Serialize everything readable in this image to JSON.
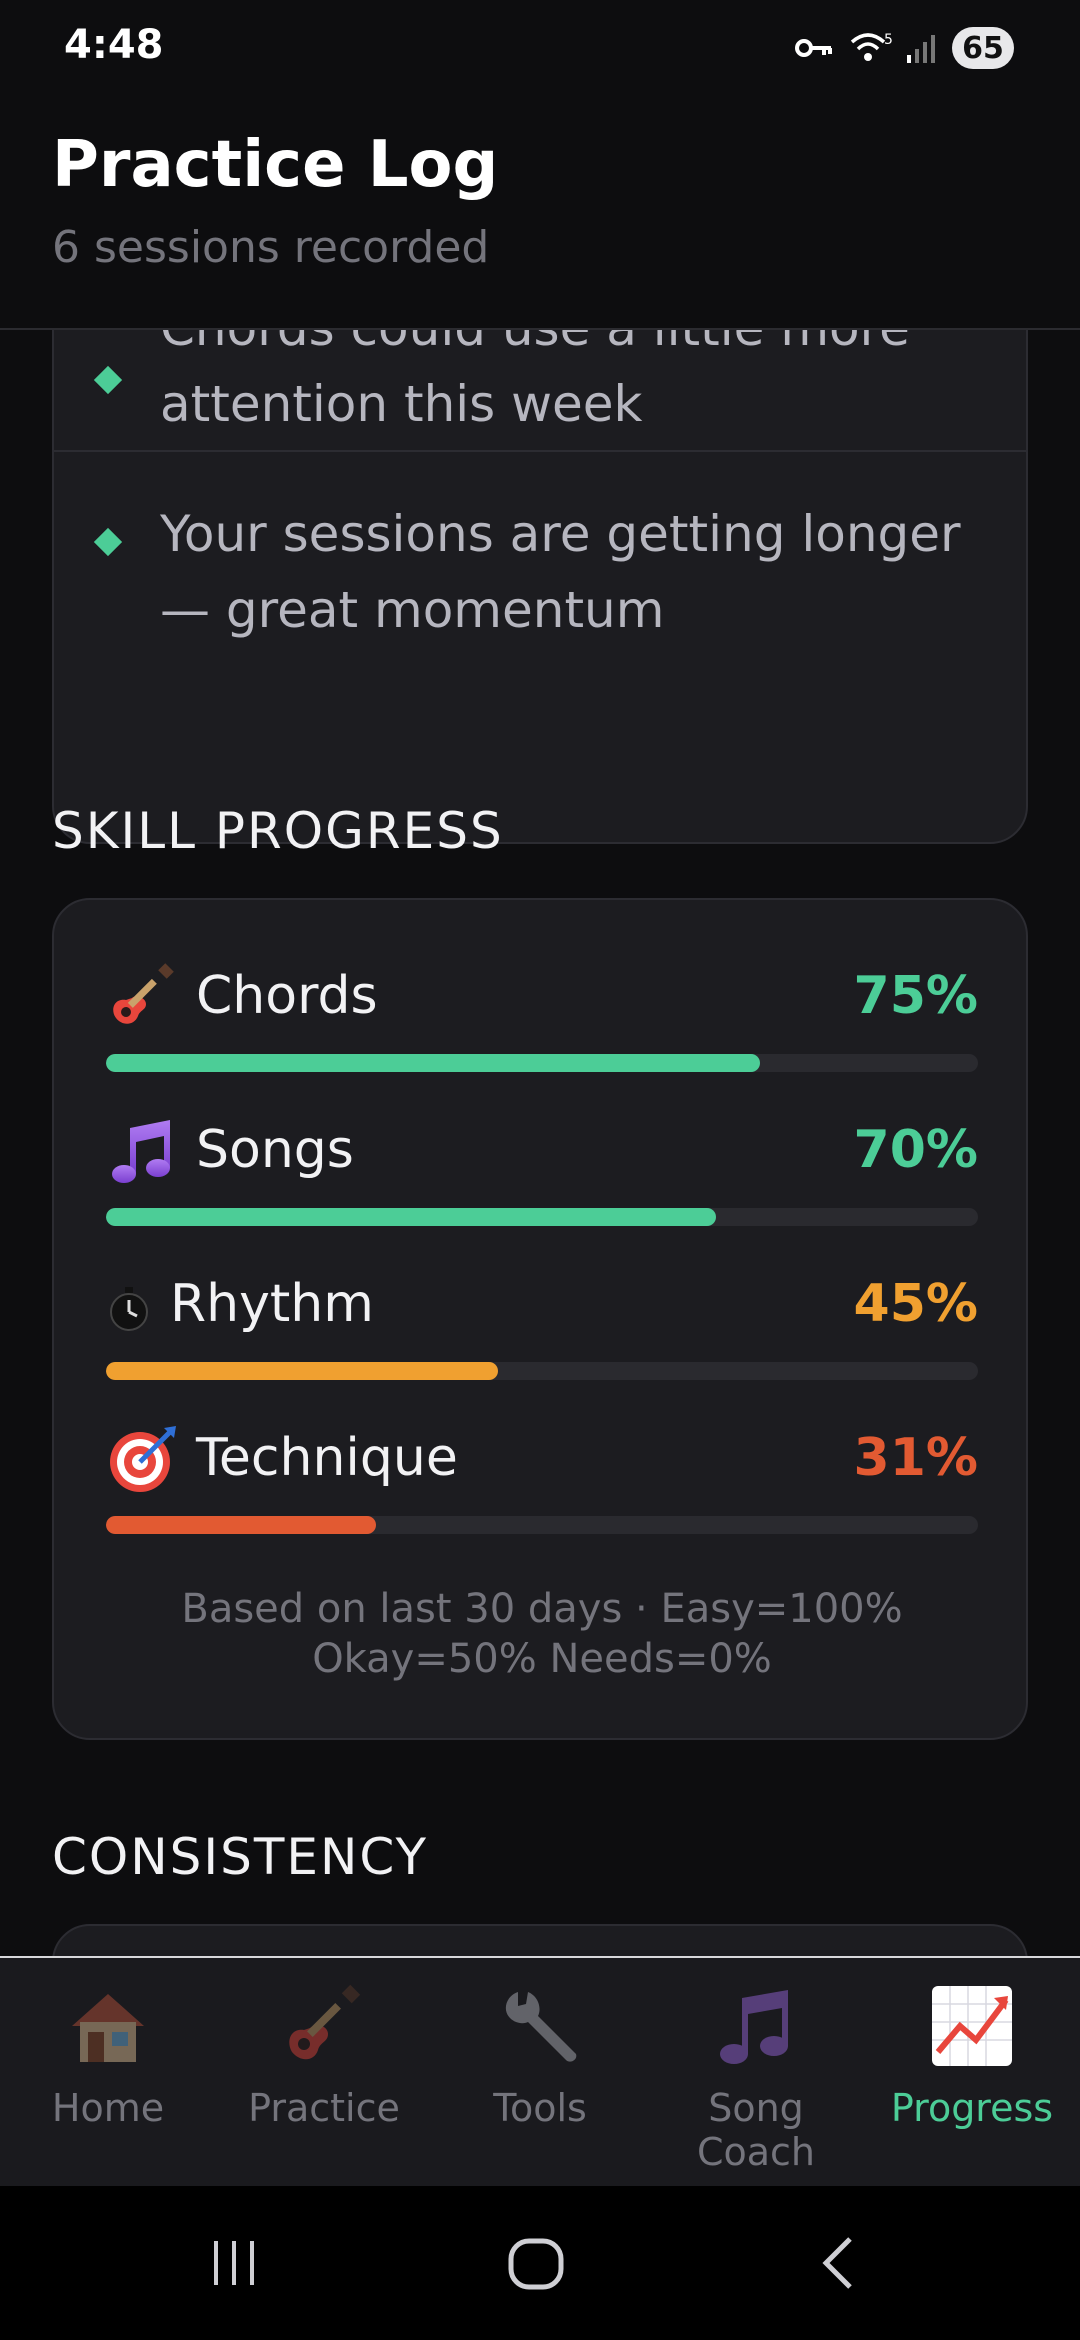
{
  "status_bar": {
    "time": "4:48",
    "battery": "65",
    "wifi_badge": "5"
  },
  "header": {
    "title": "Practice Log",
    "subtitle": "6 sessions recorded"
  },
  "insights": [
    {
      "text": "Chords could use a little more attention this week"
    },
    {
      "text": "Your sessions are getting longer — great momentum"
    }
  ],
  "skill_progress": {
    "heading": "SKILL PROGRESS",
    "items": [
      {
        "name": "Chords",
        "icon": "guitar-icon",
        "percent_label": "75%",
        "value": 75,
        "color": "#4ccd97"
      },
      {
        "name": "Songs",
        "icon": "music-note-icon",
        "percent_label": "70%",
        "value": 70,
        "color": "#4ccd97"
      },
      {
        "name": "Rhythm",
        "icon": "stopwatch-icon",
        "percent_label": "45%",
        "value": 45,
        "color": "#f0a030"
      },
      {
        "name": "Technique",
        "icon": "target-icon",
        "percent_label": "31%",
        "value": 31,
        "color": "#e25a32"
      }
    ],
    "note": "Based on last 30 days · Easy=100% Okay=50% Needs=0%"
  },
  "consistency": {
    "heading": "CONSISTENCY"
  },
  "bottom_nav": [
    {
      "label": "Home",
      "icon": "house-icon",
      "active": false
    },
    {
      "label": "Practice",
      "icon": "guitar-icon",
      "active": false
    },
    {
      "label": "Tools",
      "icon": "wrench-icon",
      "active": false
    },
    {
      "label": "Song Coach",
      "icon": "music-note-icon",
      "active": false
    },
    {
      "label": "Progress",
      "icon": "chart-increasing-icon",
      "active": true
    }
  ],
  "colors": {
    "accent": "#4ccd97",
    "warning": "#f0a030",
    "danger": "#e25a32",
    "background": "#0d0d0f",
    "card": "#1c1c20"
  }
}
